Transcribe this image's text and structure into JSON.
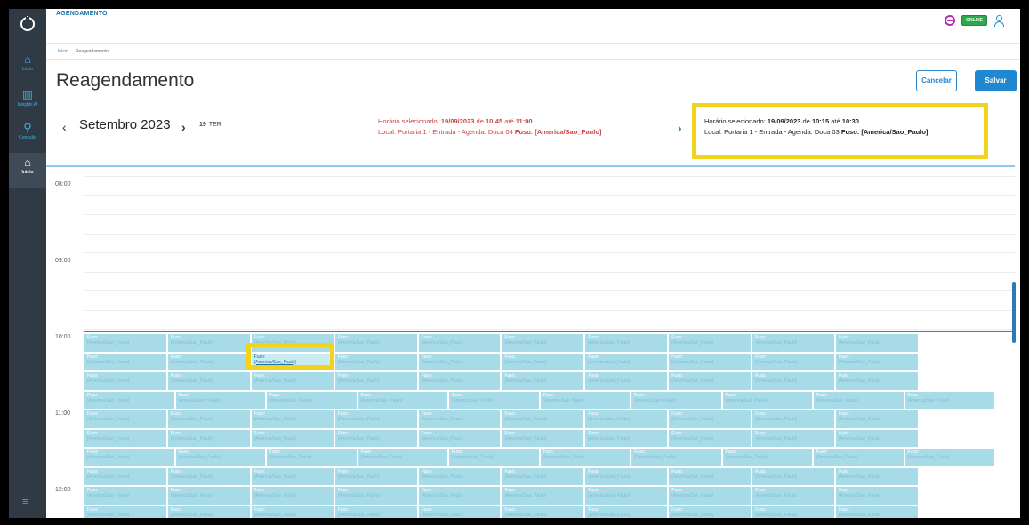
{
  "app": {
    "section_title": "AGENDAMENTO",
    "online_label": "ONLINE"
  },
  "sidebar": {
    "items": [
      {
        "label": "Início",
        "icon": "home-icon"
      },
      {
        "label": "Insights AI",
        "icon": "chart-icon"
      },
      {
        "label": "Consulta",
        "icon": "search-icon"
      },
      {
        "label": "Início",
        "icon": "home-icon"
      }
    ]
  },
  "breadcrumb": {
    "home": "Início",
    "current": "Reagendamento"
  },
  "page": {
    "title": "Reagendamento",
    "cancel_label": "Cancelar",
    "save_label": "Salvar"
  },
  "date_nav": {
    "month": "Setembro 2023",
    "day_number": "19",
    "day_name": "TER"
  },
  "original_slot": {
    "prefix": "Horário selecionado:",
    "date": "19/09/2023",
    "de": "de",
    "start": "10:45",
    "ate": "até",
    "end": "11:00",
    "local_line": "Local: Portaria 1 - Entrada - Agenda: Doca 04",
    "fuso_label": "Fuso:",
    "fuso_value": "[America/Sao_Paulo]"
  },
  "new_slot": {
    "prefix": "Horário selecionado:",
    "date": "19/09/2023",
    "de": "de",
    "start": "10:15",
    "ate": "até",
    "end": "10:30",
    "local_line": "Local: Portaria 1 - Entrada - Agenda: Doca 03",
    "fuso_label": "Fuso:",
    "fuso_value": "[America/Sao_Paulo]"
  },
  "calendar": {
    "time_labels": [
      "08:00",
      "09:00",
      "10:00",
      "11:00",
      "12:00"
    ],
    "slot_line1": "Fuso:",
    "slot_line2": "[America/Sao_Paulo]",
    "colors": {
      "slot": "#a8dbe8",
      "now_line": "#e0403a",
      "highlight": "#f3d21b"
    }
  }
}
